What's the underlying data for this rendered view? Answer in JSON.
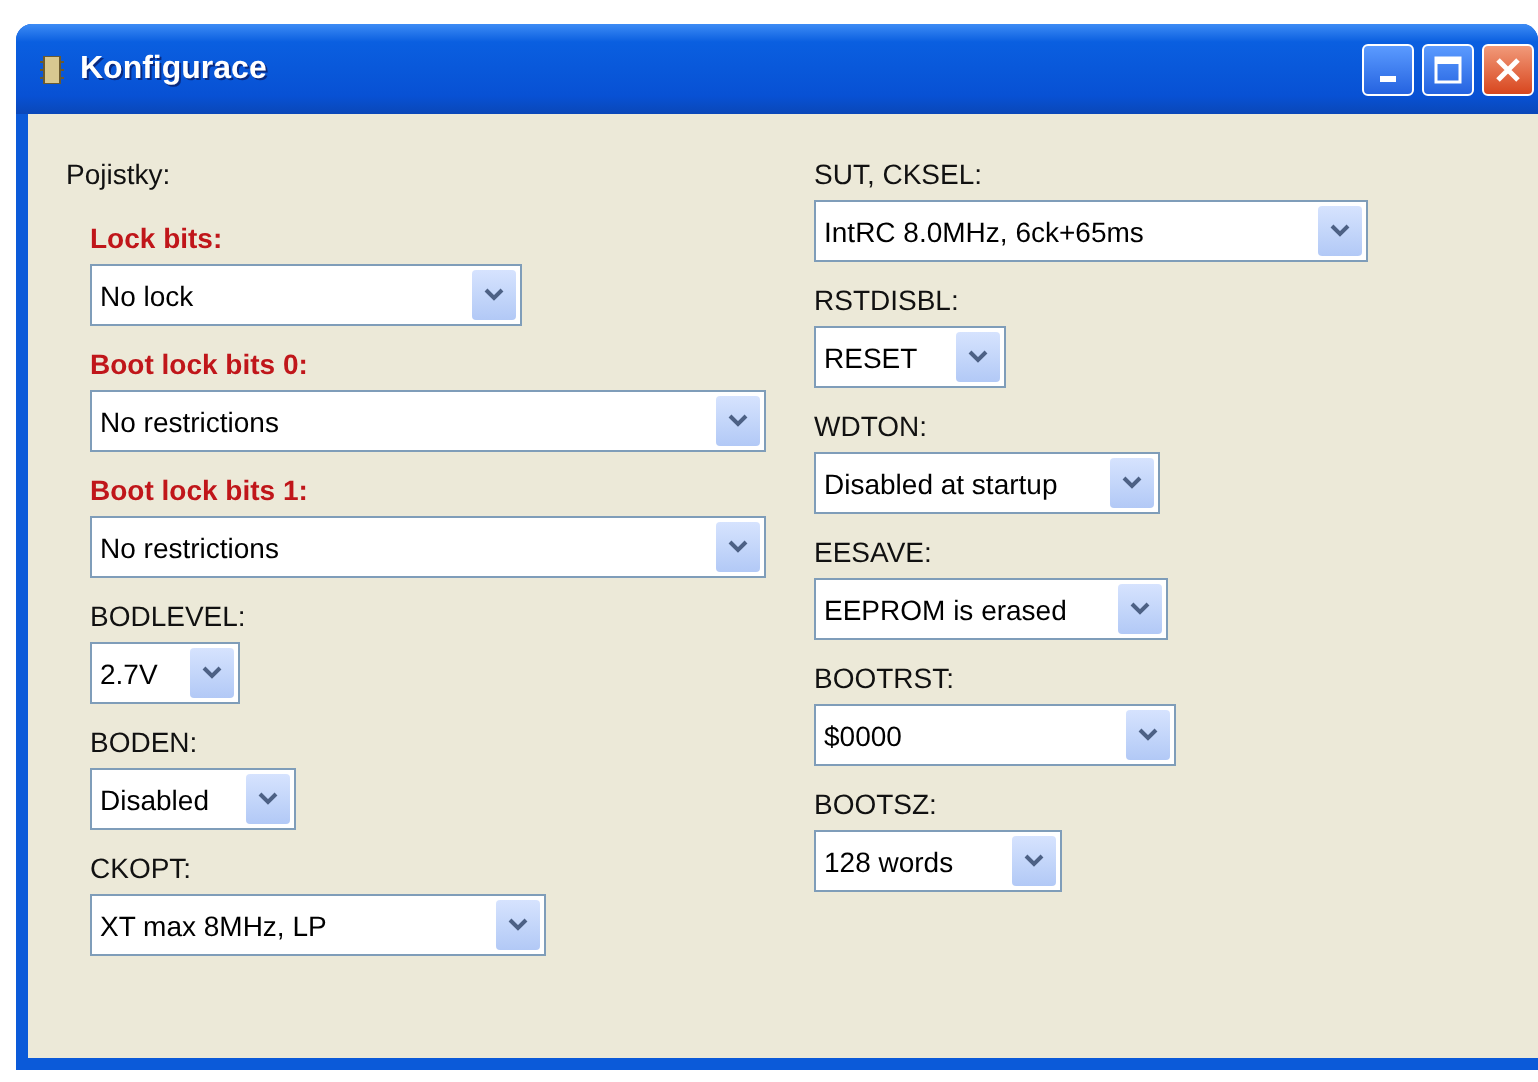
{
  "window": {
    "title": "Konfigurace"
  },
  "group_label": "Pojistky:",
  "left_fields": [
    {
      "label": "Lock bits:",
      "highlighted": true,
      "value": "No lock"
    },
    {
      "label": "Boot lock bits 0:",
      "highlighted": true,
      "value": "No restrictions"
    },
    {
      "label": "Boot lock bits 1:",
      "highlighted": true,
      "value": "No restrictions"
    },
    {
      "label": "BODLEVEL:",
      "highlighted": false,
      "value": "2.7V"
    },
    {
      "label": "BODEN:",
      "highlighted": false,
      "value": "Disabled"
    },
    {
      "label": "CKOPT:",
      "highlighted": false,
      "value": "XT max 8MHz, LP"
    }
  ],
  "right_fields": [
    {
      "label": "SUT, CKSEL:",
      "highlighted": false,
      "value": "IntRC 8.0MHz, 6ck+65ms"
    },
    {
      "label": "RSTDISBL:",
      "highlighted": false,
      "value": "RESET"
    },
    {
      "label": "WDTON:",
      "highlighted": false,
      "value": "Disabled at startup"
    },
    {
      "label": "EESAVE:",
      "highlighted": false,
      "value": "EEPROM is erased"
    },
    {
      "label": "BOOTRST:",
      "highlighted": false,
      "value": "$0000"
    },
    {
      "label": "BOOTSZ:",
      "highlighted": false,
      "value": "128 words"
    }
  ]
}
